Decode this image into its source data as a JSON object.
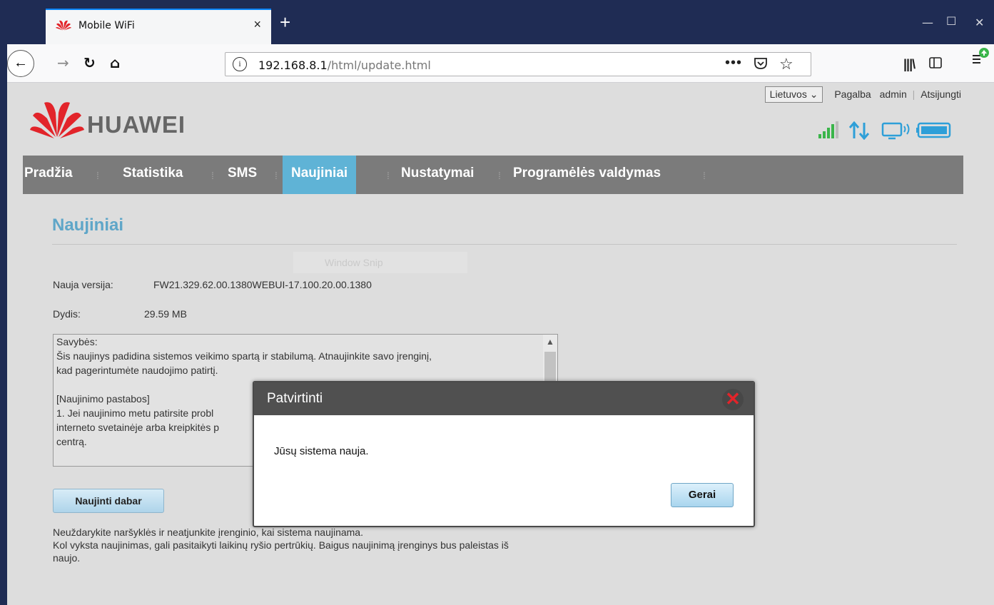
{
  "browser": {
    "tab_title": "Mobile WiFi",
    "tab_close": "×",
    "new_tab": "+",
    "url_host": "192.168.8.1",
    "url_path": "/html/update.html",
    "page_actions": "•••",
    "window_controls": {
      "minimize": "—",
      "maximize": "☐",
      "close": "✕"
    }
  },
  "top": {
    "language": "Lietuvos",
    "help": "Pagalba",
    "user": "admin",
    "logout": "Atsijungti"
  },
  "brand": {
    "name": "HUAWEI",
    "color": "#e2242a"
  },
  "menu": {
    "items": [
      {
        "label": "Pradžia"
      },
      {
        "label": "Statistika"
      },
      {
        "label": "SMS"
      },
      {
        "label": "Naujiniai"
      },
      {
        "label": "Nustatymai"
      },
      {
        "label": "Programėlės valdymas"
      }
    ],
    "active": "Naujiniai",
    "active_color": "#5fb3d6"
  },
  "content": {
    "title": "Naujiniai",
    "snip_overlay": "Window Snip",
    "version_label": "Nauja versija:",
    "version_value": "FW21.329.62.00.1380WEBUI-17.100.20.00.1380",
    "size_label": "Dydis:",
    "size_value": "29.59 MB",
    "notes": [
      "Savybės:",
      "Šis naujinys padidina sistemos veikimo spartą ir stabilumą. Atnaujinkite savo įrenginį,",
      "kad pagerintumėte naudojimo patirtį.",
      "",
      "[Naujinimo pastabos]",
      "1. Jei naujinimo metu patirsite probl",
      "interneto svetainėje arba kreipkitės p",
      "centrą."
    ],
    "update_button": "Naujinti dabar",
    "help_lines": [
      "Neuždarykite naršyklės ir neatjunkite įrenginio, kai sistema naujinama.",
      "Kol vyksta naujinimas, gali pasitaikyti laikinų ryšio pertrūkių. Baigus naujinimą įrenginys bus paleistas iš",
      "naujo."
    ]
  },
  "dialog": {
    "title": "Patvirtinti",
    "close": "✕",
    "message": "Jūsų sistema nauja.",
    "ok": "Gerai"
  }
}
